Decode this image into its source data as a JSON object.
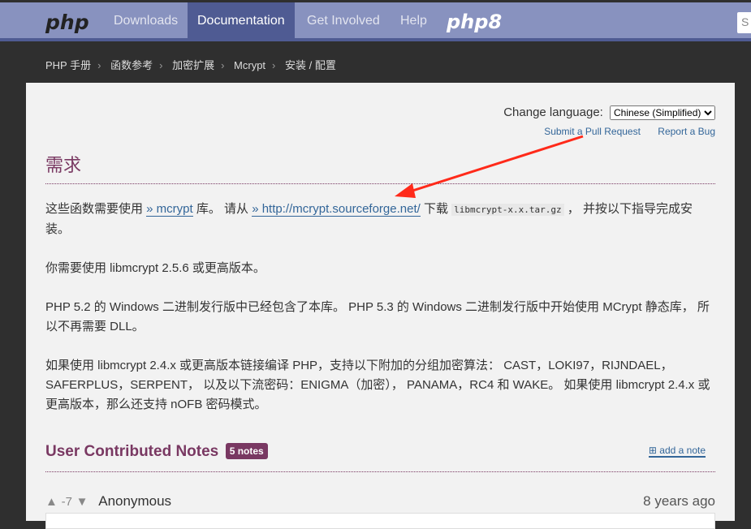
{
  "nav": {
    "logo": "php",
    "items": [
      "Downloads",
      "Documentation",
      "Get Involved",
      "Help"
    ],
    "active": "Documentation",
    "php8": "php8",
    "search_placeholder": "S"
  },
  "breadcrumb": [
    "PHP 手册",
    "函数参考",
    "加密扩展",
    "Mcrypt",
    "安装 / 配置"
  ],
  "language": {
    "label": "Change language:",
    "selected": "Chinese (Simplified)"
  },
  "links": {
    "pull": "Submit a Pull Request",
    "bug": "Report a Bug"
  },
  "title": "需求",
  "p1": {
    "a": "这些函数需要使用 ",
    "link1": "» mcrypt",
    "b": " 库。 请从 ",
    "link2": "» http://mcrypt.sourceforge.net/",
    "c": " 下载 ",
    "code": "libmcrypt-x.x.tar.gz",
    "d": " ， 并按以下指导完成安装。"
  },
  "p2": "你需要使用 libmcrypt 2.5.6 或更高版本。",
  "p3": "PHP 5.2 的 Windows 二进制发行版中已经包含了本库。 PHP 5.3 的 Windows 二进制发行版中开始使用 MCrypt 静态库， 所以不再需要 DLL。",
  "p4": "如果使用 libmcrypt 2.4.x 或更高版本链接编译 PHP，支持以下附加的分组加密算法： CAST，LOKI97，RIJNDAEL，SAFERPLUS，SERPENT， 以及以下流密码：ENIGMA（加密）， PANAMA，RC4 和 WAKE。 如果使用 libmcrypt 2.4.x 或更高版本，那么还支持 nOFB 密码模式。",
  "notes": {
    "title": "User Contributed Notes",
    "count": "5 notes",
    "add": "add a note"
  },
  "note": {
    "score": "-7",
    "author": "Anonymous",
    "age": "8 years ago"
  },
  "annotation_color": "#ff2a1a"
}
